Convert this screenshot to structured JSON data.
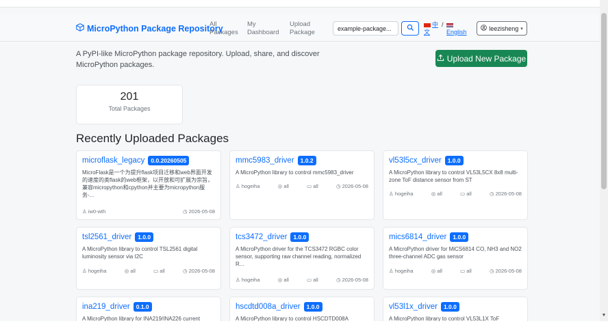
{
  "navbar": {
    "brand": "MicroPython Package Repository",
    "links": {
      "all_packages": [
        "All",
        "Packages"
      ],
      "my_dashboard": [
        "My",
        "Dashboard"
      ],
      "upload_package": [
        "Upload",
        "Package"
      ]
    },
    "search": {
      "value": "example-package..."
    },
    "lang": {
      "zh_top": "中",
      "zh_bottom": "文",
      "sep": "/",
      "en": "English"
    },
    "user": "leezisheng"
  },
  "intro": {
    "text": "A PyPI-like MicroPython package repository. Upload, share, and discover MicroPython packages.",
    "upload_button": "Upload New Package"
  },
  "stats": {
    "total": "201",
    "label": "Total Packages"
  },
  "section_title": "Recently Uploaded Packages",
  "packages": [
    {
      "name": "microflask_legacy",
      "version": "0.0.20260505",
      "description": "MicroFlask是一个为提升flask项目迁移和web界面开发的速度的类flask的web框架，以开放和可扩展为宗旨，兼容micropython和cpython并主要为micropython服务-...",
      "author": "iw0-wth",
      "date": "2026-05-08"
    },
    {
      "name": "mmc5983_driver",
      "version": "1.0.2",
      "description": "A MicroPython library to control mmc5983_driver",
      "author": "hogeiha",
      "platform": "all",
      "firmware": "all",
      "date": "2026-05-08"
    },
    {
      "name": "vl53l5cx_driver",
      "version": "1.0.0",
      "description": "A MicroPython library to control VL53L5CX 8x8 multi-zone ToF distance sensor from ST",
      "author": "hogeiha",
      "platform": "all",
      "firmware": "all",
      "date": "2026-05-08"
    },
    {
      "name": "tsl2561_driver",
      "version": "1.0.0",
      "description": "A MicroPython library to control TSL2561 digital luminosity sensor via I2C",
      "author": "hogeiha",
      "platform": "all",
      "firmware": "all",
      "date": "2026-05-08"
    },
    {
      "name": "tcs3472_driver",
      "version": "1.0.0",
      "description": "A MicroPython driver for the TCS3472 RGBC color sensor, supporting raw channel reading, normalized R...",
      "author": "hogeiha",
      "platform": "all",
      "firmware": "all",
      "date": "2026-05-08"
    },
    {
      "name": "mics6814_driver",
      "version": "1.0.0",
      "description": "A MicroPython driver for MiCS6814 CO, NH3 and NO2 three-channel ADC gas sensor",
      "author": "hogeiha",
      "platform": "all",
      "firmware": "all",
      "date": "2026-05-08"
    },
    {
      "name": "ina219_driver",
      "version": "0.1.0",
      "description": "A MicroPython library for INA219/INA226 current"
    },
    {
      "name": "hscdtd008a_driver",
      "version": "1.0.0",
      "description": "A MicroPython library to control HSCDTD008A"
    },
    {
      "name": "vl53l1x_driver",
      "version": "1.0.0",
      "description": "A MicroPython library to control VL53L1X ToF"
    }
  ]
}
